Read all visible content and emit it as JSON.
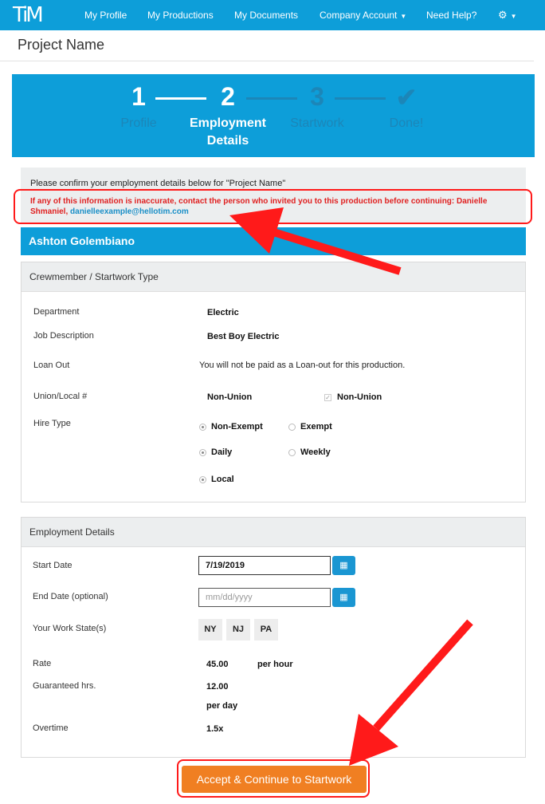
{
  "nav": {
    "logo": "TiM",
    "items": [
      "My Profile",
      "My Productions",
      "My Documents",
      "Company Account",
      "Need Help?"
    ],
    "brand_color": "#0d9ed9"
  },
  "project": {
    "title": "Project Name"
  },
  "stepper": {
    "steps": [
      {
        "num": "1",
        "label": "Profile",
        "state": "complete"
      },
      {
        "num": "2",
        "label": "Employment Details",
        "label_line1": "Employment",
        "label_line2": "Details",
        "state": "current"
      },
      {
        "num": "3",
        "label": "Startwork",
        "state": "todo"
      },
      {
        "num": "✔",
        "label": "Done!",
        "state": "todo"
      }
    ]
  },
  "confirm": {
    "text": "Please confirm your employment details below for \"Project Name\"",
    "warning": "If any of this information is inaccurate, contact the person who invited you to this production before continuing: Danielle Shmaniel,",
    "email": "danielleexample@hellotim.com"
  },
  "person": {
    "name": "Ashton Golembiano"
  },
  "crew": {
    "title": "Crewmember / Startwork Type",
    "department_label": "Department",
    "department": "Electric",
    "job_label": "Job Description",
    "job": "Best Boy Electric",
    "loanout_label": "Loan Out",
    "loanout": "You will not be paid as a Loan-out for this production.",
    "union_label": "Union/Local #",
    "union_value": "Non-Union",
    "union_check": "Non-Union",
    "hire_label": "Hire Type",
    "hire_options": [
      {
        "label": "Non-Exempt",
        "selected": true
      },
      {
        "label": "Exempt",
        "selected": false
      },
      {
        "label": "Daily",
        "selected": true
      },
      {
        "label": "Weekly",
        "selected": false
      },
      {
        "label": "Local",
        "selected": true
      }
    ]
  },
  "employment": {
    "title": "Employment Details",
    "start_label": "Start Date",
    "start_value": "7/19/2019",
    "end_label": "End Date (optional)",
    "end_placeholder": "mm/dd/yyyy",
    "states_label": "Your Work State(s)",
    "states": [
      "NY",
      "NJ",
      "PA"
    ],
    "rate_label": "Rate",
    "rate": "45.00",
    "rate_unit": "per hour",
    "guaranteed_label": "Guaranteed hrs.",
    "guaranteed": "12.00",
    "guaranteed_unit": "per day",
    "overtime_label": "Overtime",
    "overtime": "1.5x"
  },
  "accept_button": {
    "label": "Accept & Continue to Startwork",
    "color": "#f07f22"
  },
  "annotation_color": "#ff1a1a"
}
